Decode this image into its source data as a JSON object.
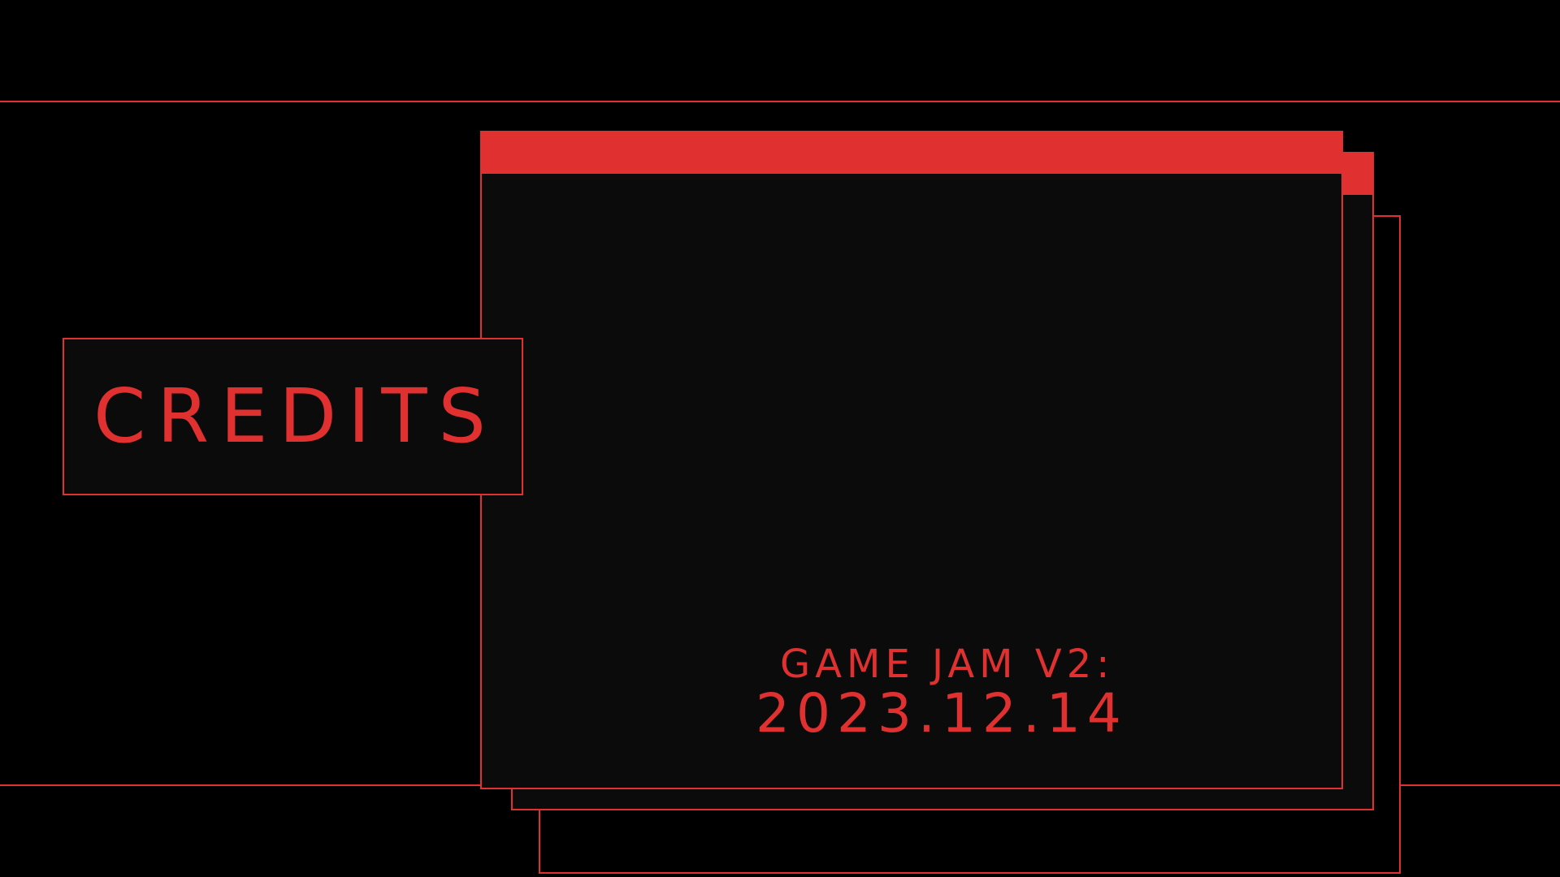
{
  "screen": {
    "title": "CREDITS",
    "event_name": "GAME JAM V2:",
    "event_date": "2023.12.14"
  },
  "colors": {
    "accent": "#e03030",
    "background": "#000000",
    "panel": "#0b0b0b"
  }
}
